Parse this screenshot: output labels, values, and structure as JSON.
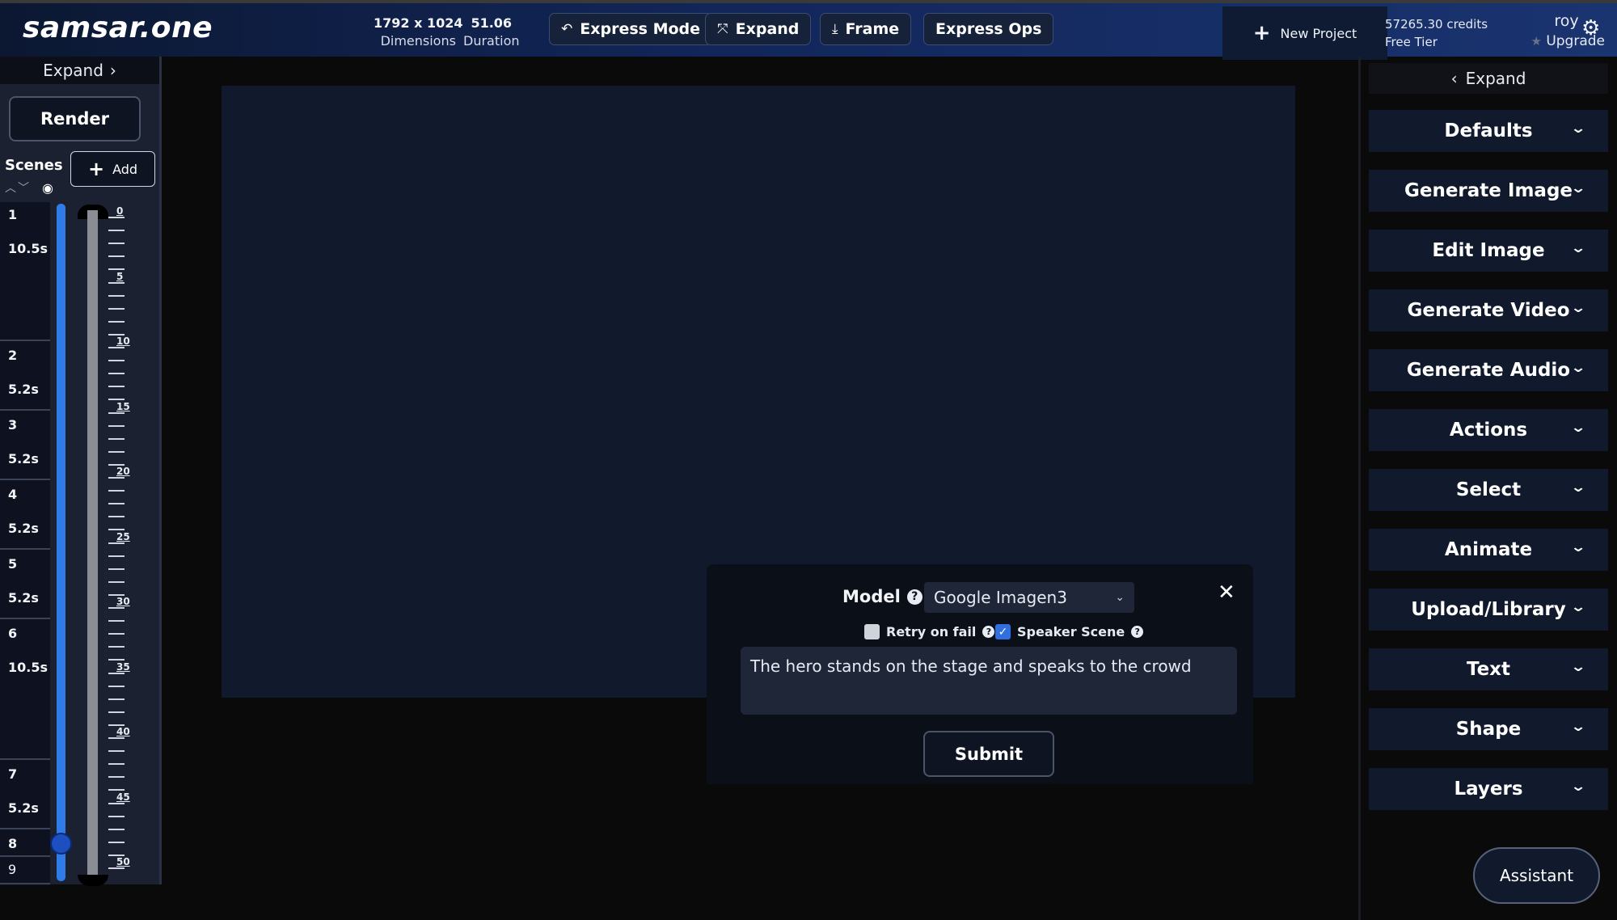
{
  "app": {
    "logo": "samsar.one"
  },
  "header": {
    "dimensions_value": "1792 x 1024",
    "dimensions_label": "Dimensions",
    "duration_value": "51.06",
    "duration_label": "Duration",
    "buttons": [
      {
        "label": "Express Mode",
        "icon": "undo-arrow-icon"
      },
      {
        "label": "Expand",
        "icon": "expand-arrows-icon"
      },
      {
        "label": "Frame",
        "icon": "download-icon"
      },
      {
        "label": "Express Ops",
        "icon": ""
      }
    ],
    "new_project_label": "New Project",
    "credits": "57265.30 credits",
    "tier": "Free Tier",
    "username": "roy",
    "upgrade_label": "Upgrade"
  },
  "left": {
    "expand_label": "Expand",
    "render_label": "Render",
    "scenes_label": "Scenes",
    "add_label": "Add",
    "scenes": [
      {
        "num": "1",
        "dur": "10.5s"
      },
      {
        "num": "2",
        "dur": "5.2s"
      },
      {
        "num": "3",
        "dur": "5.2s"
      },
      {
        "num": "4",
        "dur": "5.2s"
      },
      {
        "num": "5",
        "dur": "5.2s"
      },
      {
        "num": "6",
        "dur": "10.5s"
      },
      {
        "num": "7",
        "dur": "5.2s"
      },
      {
        "num": "8",
        "dur": ""
      },
      {
        "num": "9",
        "dur": ""
      }
    ],
    "ruler_labels": [
      "0",
      "5",
      "10",
      "15",
      "20",
      "25",
      "30",
      "35",
      "40",
      "45",
      "50"
    ]
  },
  "prompt": {
    "model_label": "Model",
    "model_value": "Google Imagen3",
    "retry_label": "Retry on fail",
    "retry_checked": false,
    "speaker_label": "Speaker Scene",
    "speaker_checked": true,
    "text": "The hero stands on the stage and speaks to the crowd",
    "submit_label": "Submit"
  },
  "right": {
    "expand_label": "Expand",
    "sections": [
      "Defaults",
      "Generate Image",
      "Edit Image",
      "Generate Video",
      "Generate Audio",
      "Actions",
      "Select",
      "Animate",
      "Upload/Library",
      "Text",
      "Shape",
      "Layers"
    ],
    "assistant_label": "Assistant"
  },
  "colors": {
    "accent": "#2f7be8",
    "panel": "#111a2c",
    "header_start": "#0c1832",
    "header_end": "#1a3470"
  }
}
